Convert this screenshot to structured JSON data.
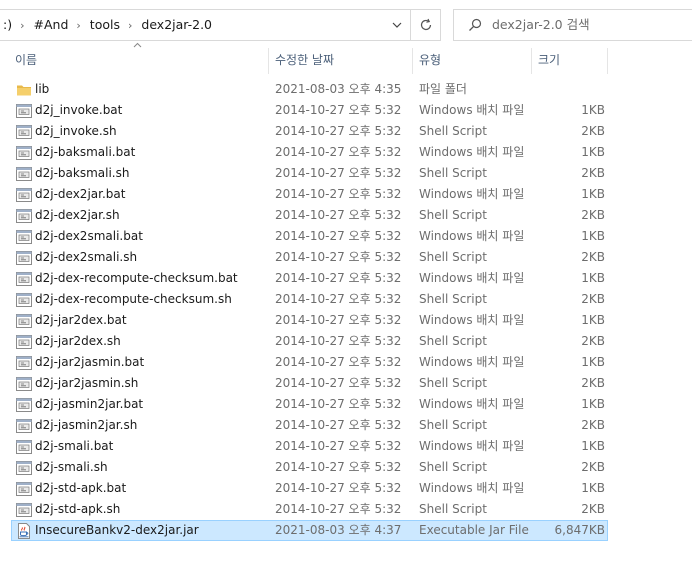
{
  "address_bar": {
    "crumbs": [
      ":)",
      "#And",
      "tools",
      "dex2jar-2.0"
    ],
    "separator": "›"
  },
  "search": {
    "placeholder": "dex2jar-2.0 검색"
  },
  "columns": {
    "name": "이름",
    "date": "수정한 날짜",
    "type": "유형",
    "size": "크기"
  },
  "colors": {
    "selection_bg": "#cce8ff",
    "selection_border": "#99d1ff",
    "header_text": "#4c607a",
    "folder": "#e8b94a"
  },
  "files": [
    {
      "name": "lib",
      "date": "2021-08-03 오후 4:35",
      "type": "파일 폴더",
      "size": "",
      "icon": "folder-icon",
      "selected": false
    },
    {
      "name": "d2j_invoke.bat",
      "date": "2014-10-27 오후 5:32",
      "type": "Windows 배치 파일",
      "size": "1KB",
      "icon": "batch-file-icon",
      "selected": false
    },
    {
      "name": "d2j_invoke.sh",
      "date": "2014-10-27 오후 5:32",
      "type": "Shell Script",
      "size": "2KB",
      "icon": "script-file-icon",
      "selected": false
    },
    {
      "name": "d2j-baksmali.bat",
      "date": "2014-10-27 오후 5:32",
      "type": "Windows 배치 파일",
      "size": "1KB",
      "icon": "batch-file-icon",
      "selected": false
    },
    {
      "name": "d2j-baksmali.sh",
      "date": "2014-10-27 오후 5:32",
      "type": "Shell Script",
      "size": "2KB",
      "icon": "script-file-icon",
      "selected": false
    },
    {
      "name": "d2j-dex2jar.bat",
      "date": "2014-10-27 오후 5:32",
      "type": "Windows 배치 파일",
      "size": "1KB",
      "icon": "batch-file-icon",
      "selected": false
    },
    {
      "name": "d2j-dex2jar.sh",
      "date": "2014-10-27 오후 5:32",
      "type": "Shell Script",
      "size": "2KB",
      "icon": "script-file-icon",
      "selected": false
    },
    {
      "name": "d2j-dex2smali.bat",
      "date": "2014-10-27 오후 5:32",
      "type": "Windows 배치 파일",
      "size": "1KB",
      "icon": "batch-file-icon",
      "selected": false
    },
    {
      "name": "d2j-dex2smali.sh",
      "date": "2014-10-27 오후 5:32",
      "type": "Shell Script",
      "size": "2KB",
      "icon": "script-file-icon",
      "selected": false
    },
    {
      "name": "d2j-dex-recompute-checksum.bat",
      "date": "2014-10-27 오후 5:32",
      "type": "Windows 배치 파일",
      "size": "1KB",
      "icon": "batch-file-icon",
      "selected": false
    },
    {
      "name": "d2j-dex-recompute-checksum.sh",
      "date": "2014-10-27 오후 5:32",
      "type": "Shell Script",
      "size": "2KB",
      "icon": "script-file-icon",
      "selected": false
    },
    {
      "name": "d2j-jar2dex.bat",
      "date": "2014-10-27 오후 5:32",
      "type": "Windows 배치 파일",
      "size": "1KB",
      "icon": "batch-file-icon",
      "selected": false
    },
    {
      "name": "d2j-jar2dex.sh",
      "date": "2014-10-27 오후 5:32",
      "type": "Shell Script",
      "size": "2KB",
      "icon": "script-file-icon",
      "selected": false
    },
    {
      "name": "d2j-jar2jasmin.bat",
      "date": "2014-10-27 오후 5:32",
      "type": "Windows 배치 파일",
      "size": "1KB",
      "icon": "batch-file-icon",
      "selected": false
    },
    {
      "name": "d2j-jar2jasmin.sh",
      "date": "2014-10-27 오후 5:32",
      "type": "Shell Script",
      "size": "2KB",
      "icon": "script-file-icon",
      "selected": false
    },
    {
      "name": "d2j-jasmin2jar.bat",
      "date": "2014-10-27 오후 5:32",
      "type": "Windows 배치 파일",
      "size": "1KB",
      "icon": "batch-file-icon",
      "selected": false
    },
    {
      "name": "d2j-jasmin2jar.sh",
      "date": "2014-10-27 오후 5:32",
      "type": "Shell Script",
      "size": "2KB",
      "icon": "script-file-icon",
      "selected": false
    },
    {
      "name": "d2j-smali.bat",
      "date": "2014-10-27 오후 5:32",
      "type": "Windows 배치 파일",
      "size": "1KB",
      "icon": "batch-file-icon",
      "selected": false
    },
    {
      "name": "d2j-smali.sh",
      "date": "2014-10-27 오후 5:32",
      "type": "Shell Script",
      "size": "2KB",
      "icon": "script-file-icon",
      "selected": false
    },
    {
      "name": "d2j-std-apk.bat",
      "date": "2014-10-27 오후 5:32",
      "type": "Windows 배치 파일",
      "size": "1KB",
      "icon": "batch-file-icon",
      "selected": false
    },
    {
      "name": "d2j-std-apk.sh",
      "date": "2014-10-27 오후 5:32",
      "type": "Shell Script",
      "size": "2KB",
      "icon": "script-file-icon",
      "selected": false
    },
    {
      "name": "InsecureBankv2-dex2jar.jar",
      "date": "2021-08-03 오후 4:37",
      "type": "Executable Jar File",
      "size": "6,847KB",
      "icon": "jar-file-icon",
      "selected": true
    }
  ]
}
